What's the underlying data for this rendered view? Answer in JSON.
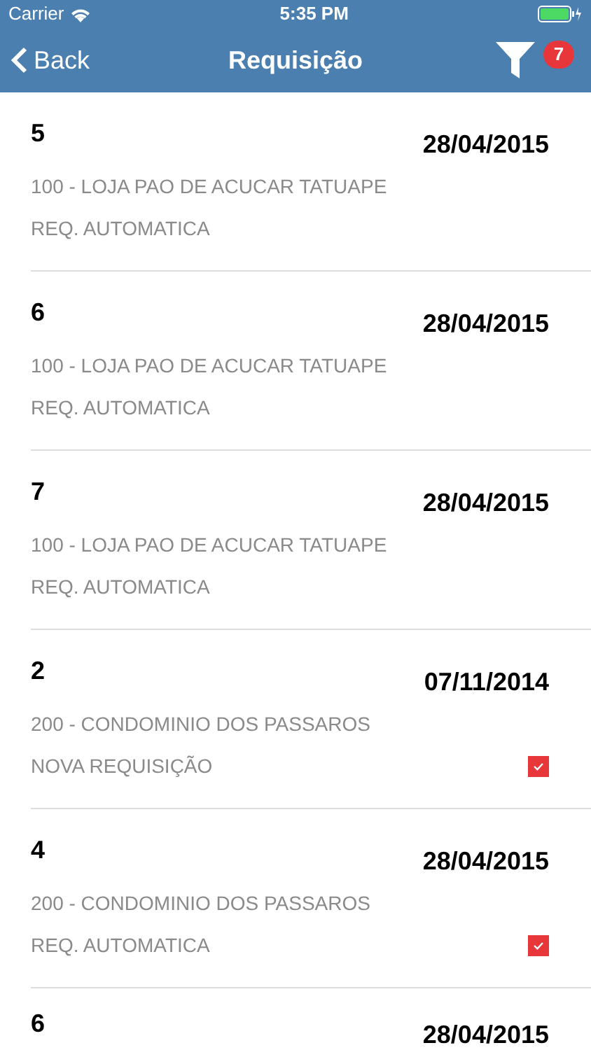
{
  "status_bar": {
    "carrier": "Carrier",
    "time": "5:35 PM"
  },
  "nav_bar": {
    "back": "Back",
    "title": "Requisição",
    "filter_count": "7"
  },
  "rows": [
    {
      "number": "5",
      "date": "28/04/2015",
      "store": "100 - LOJA PAO DE ACUCAR TATUAPE",
      "type": "REQ. AUTOMATICA",
      "checked": false
    },
    {
      "number": "6",
      "date": "28/04/2015",
      "store": "100 - LOJA PAO DE ACUCAR TATUAPE",
      "type": "REQ. AUTOMATICA",
      "checked": false
    },
    {
      "number": "7",
      "date": "28/04/2015",
      "store": "100 - LOJA PAO DE ACUCAR TATUAPE",
      "type": "REQ. AUTOMATICA",
      "checked": false
    },
    {
      "number": "2",
      "date": "07/11/2014",
      "store": "200 - CONDOMINIO DOS PASSAROS",
      "type": "NOVA REQUISIÇÃO",
      "checked": true
    },
    {
      "number": "4",
      "date": "28/04/2015",
      "store": "200 - CONDOMINIO DOS PASSAROS",
      "type": "REQ. AUTOMATICA",
      "checked": true
    },
    {
      "number": "6",
      "date": "28/04/2015"
    }
  ]
}
